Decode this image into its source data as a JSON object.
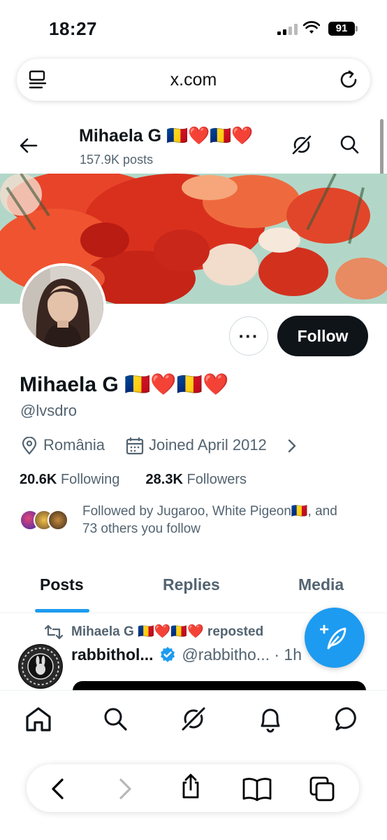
{
  "status": {
    "time": "18:27",
    "battery": "91",
    "icons": [
      "signal-icon",
      "wifi-icon",
      "battery-icon"
    ]
  },
  "browser": {
    "url": "x.com",
    "icons": [
      "reader-icon",
      "reload-icon"
    ]
  },
  "header": {
    "name": "Mihaela G 🇷🇴❤️🇷🇴❤️",
    "posts": "157.9K posts"
  },
  "profile": {
    "display_name": "Mihaela G 🇷🇴❤️🇷🇴❤️",
    "handle": "@lvsdro",
    "location": "România",
    "joined": "Joined April 2012",
    "following_count": "20.6K",
    "following_label": "Following",
    "followers_count": "28.3K",
    "followers_label": "Followers",
    "followed_by_line1": "Followed by Jugaroo, White Pigeon🇷🇴, and",
    "followed_by_line2": "73 others you follow",
    "more_label": "···",
    "follow_label": "Follow"
  },
  "tabs": [
    {
      "label": "Posts",
      "active": true
    },
    {
      "label": "Replies",
      "active": false
    },
    {
      "label": "Media",
      "active": false
    }
  ],
  "post": {
    "repost_label": "Mihaela G 🇷🇴❤️🇷🇴❤️ reposted",
    "author": "rabbithol...",
    "author_handle": "@rabbitho...",
    "time": "· 1h"
  },
  "bottom_nav": [
    "home-icon",
    "search-icon",
    "grok-icon",
    "notifications-icon",
    "messages-icon"
  ],
  "safari": [
    "back-icon",
    "forward-icon",
    "share-icon",
    "bookmarks-icon",
    "tabs-icon"
  ],
  "colors": {
    "accent": "#1d9bf0",
    "text": "#0f1419",
    "secondary": "#536471"
  }
}
